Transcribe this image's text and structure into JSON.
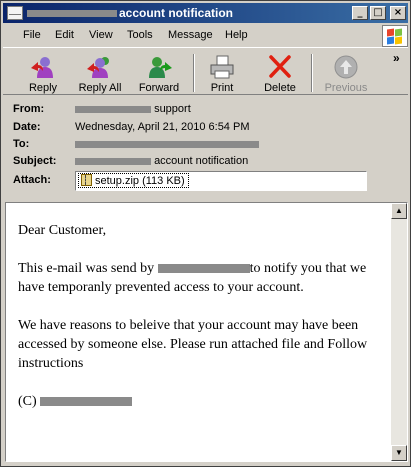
{
  "window": {
    "title": "account notification"
  },
  "menu": [
    "File",
    "Edit",
    "View",
    "Tools",
    "Message",
    "Help"
  ],
  "toolbar": {
    "reply": "Reply",
    "reply_all": "Reply All",
    "forward": "Forward",
    "print": "Print",
    "delete": "Delete",
    "previous": "Previous"
  },
  "header": {
    "from_label": "From:",
    "from_value": "support",
    "date_label": "Date:",
    "date_value": "Wednesday, April 21, 2010 6:54 PM",
    "to_label": "To:",
    "subject_label": "Subject:",
    "subject_value": "account notification",
    "attach_label": "Attach:",
    "attachment": "setup.zip (113 KB)"
  },
  "message": {
    "greeting": "Dear Customer,",
    "p1_a": "This e-mail was send by",
    "p1_b": "to notify you that we have temporanly prevented access to your account.",
    "p2": "We have reasons to beleive that your account may have been accessed by someone else. Please run attached file and Follow instructions",
    "signature_prefix": "(C)"
  },
  "colors": {
    "titlebar_start": "#0a246a",
    "titlebar_end": "#3a6ea5",
    "delete_red": "#e02010",
    "redaction_gray": "#8a8a8a"
  }
}
